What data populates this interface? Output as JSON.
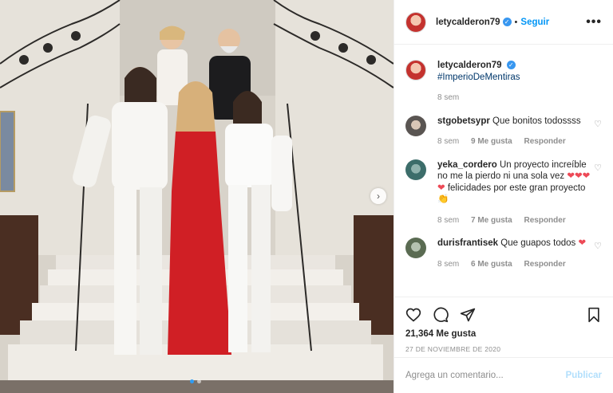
{
  "post": {
    "username": "letycalderon79",
    "follow_label": "Seguir",
    "more_label": "•••",
    "caption_hashtag": "#ImperioDeMentiras",
    "caption_time": "8 sem",
    "likes": "21,364 Me gusta",
    "date": "27 DE NOVIEMBRE DE 2020",
    "add_comment_placeholder": "Agrega un comentario...",
    "publish_label": "Publicar"
  },
  "comments": [
    {
      "user": "stgobetsypr",
      "text": "Que bonitos todossss",
      "time": "8 sem",
      "likes": "9 Me gusta",
      "reply": "Responder",
      "avatar": "gray"
    },
    {
      "user": "yeka_cordero",
      "text": "Un proyecto increíble no me la pierdo ni una sola vez",
      "hearts": "❤❤❤❤",
      "text2": "felicidades por este gran proyecto",
      "emoji": "👏",
      "time": "8 sem",
      "likes": "7 Me gusta",
      "reply": "Responder",
      "avatar": "teal"
    },
    {
      "user": "durisfrantisek",
      "text": "Que guapos todos",
      "hearts": "❤",
      "time": "8 sem",
      "likes": "6 Me gusta",
      "reply": "Responder",
      "avatar": "brown"
    }
  ],
  "icons": {
    "verified": "verified-badge-icon",
    "heart": "heart-icon",
    "comment": "comment-icon",
    "share": "share-icon",
    "bookmark": "bookmark-icon",
    "next": "chevron-right-icon"
  },
  "colors": {
    "accent": "#0095f6",
    "verified": "#3897f0",
    "heart_red": "#ed4956",
    "muted": "#8e8e8e"
  }
}
